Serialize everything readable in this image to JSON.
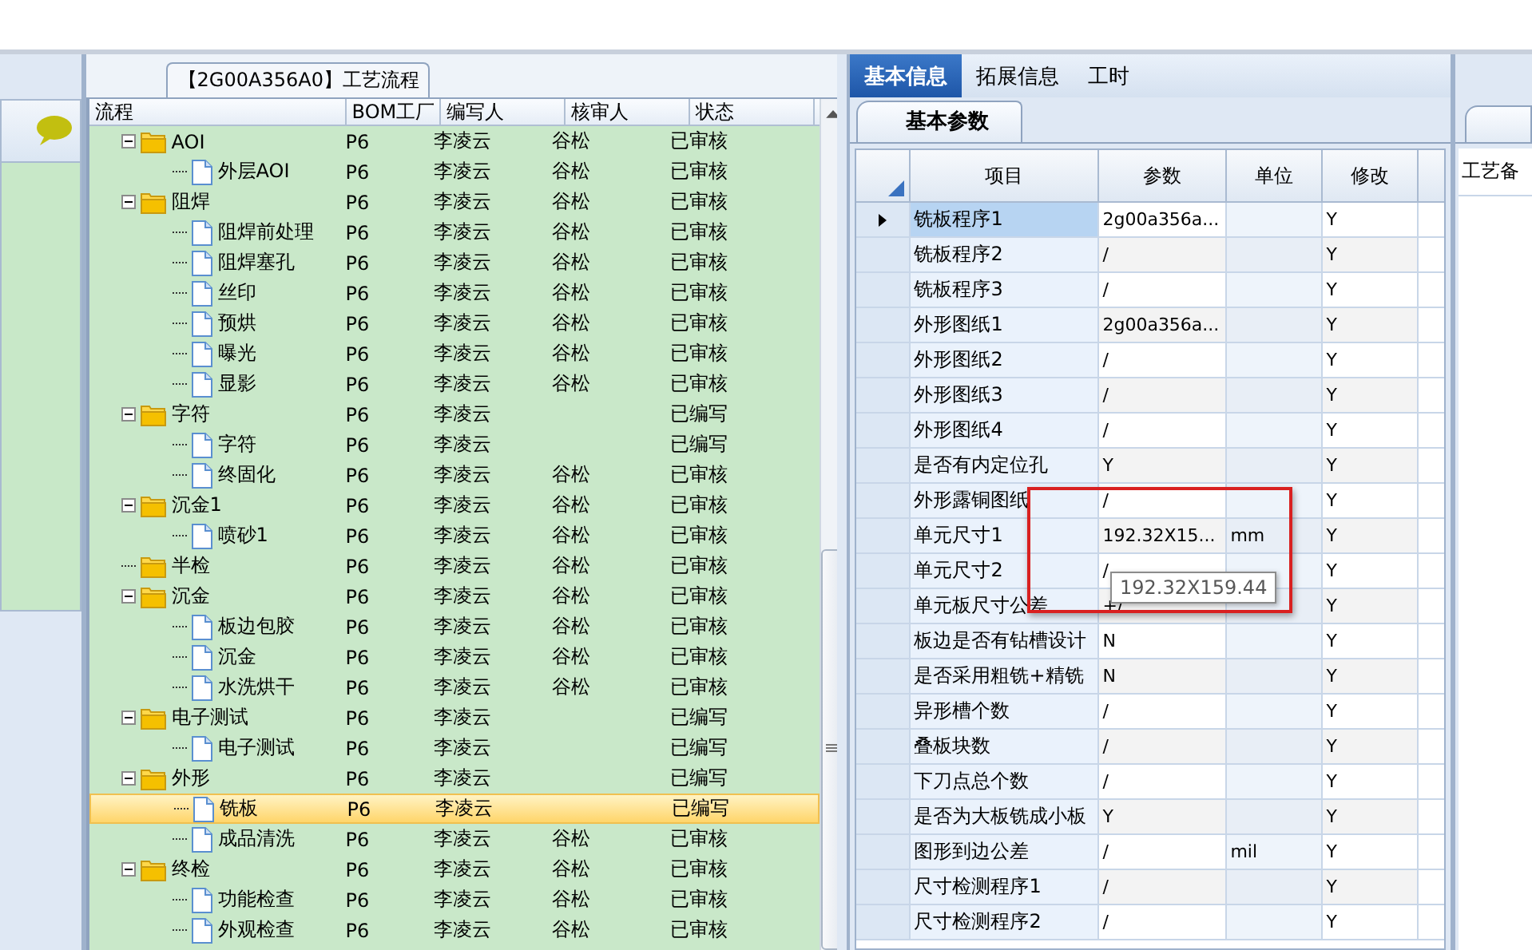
{
  "tree_panel": {
    "title": "【2G00A356A0】工艺流程",
    "columns": [
      "流程",
      "BOM工厂",
      "编写人",
      "核审人",
      "状态"
    ],
    "rows": [
      {
        "name": "AOI",
        "factory": "P6",
        "writer": "李凌云",
        "reviewer": "谷松",
        "status": "已审核",
        "selected": false,
        "expanded": true,
        "children": [
          {
            "name": "外层AOI",
            "factory": "P6",
            "writer": "李凌云",
            "reviewer": "谷松",
            "status": "已审核",
            "selected": false
          }
        ]
      },
      {
        "name": "阻焊",
        "factory": "P6",
        "writer": "李凌云",
        "reviewer": "谷松",
        "status": "已审核",
        "selected": false,
        "expanded": true,
        "children": [
          {
            "name": "阻焊前处理",
            "factory": "P6",
            "writer": "李凌云",
            "reviewer": "谷松",
            "status": "已审核",
            "selected": false
          },
          {
            "name": "阻焊塞孔",
            "factory": "P6",
            "writer": "李凌云",
            "reviewer": "谷松",
            "status": "已审核",
            "selected": false
          },
          {
            "name": "丝印",
            "factory": "P6",
            "writer": "李凌云",
            "reviewer": "谷松",
            "status": "已审核",
            "selected": false
          },
          {
            "name": "预烘",
            "factory": "P6",
            "writer": "李凌云",
            "reviewer": "谷松",
            "status": "已审核",
            "selected": false
          },
          {
            "name": "曝光",
            "factory": "P6",
            "writer": "李凌云",
            "reviewer": "谷松",
            "status": "已审核",
            "selected": false
          },
          {
            "name": "显影",
            "factory": "P6",
            "writer": "李凌云",
            "reviewer": "谷松",
            "status": "已审核",
            "selected": false
          }
        ]
      },
      {
        "name": "字符",
        "factory": "P6",
        "writer": "李凌云",
        "status": "已编写",
        "selected": false,
        "expanded": true,
        "children": [
          {
            "name": "字符",
            "factory": "P6",
            "writer": "李凌云",
            "status": "已编写",
            "selected": false
          },
          {
            "name": "终固化",
            "factory": "P6",
            "writer": "李凌云",
            "reviewer": "谷松",
            "status": "已审核",
            "selected": false
          }
        ]
      },
      {
        "name": "沉金1",
        "factory": "P6",
        "writer": "李凌云",
        "reviewer": "谷松",
        "status": "已审核",
        "selected": false,
        "expanded": true,
        "children": [
          {
            "name": "喷砂1",
            "factory": "P6",
            "writer": "李凌云",
            "reviewer": "谷松",
            "status": "已审核",
            "selected": false
          }
        ]
      },
      {
        "name": "半检",
        "factory": "P6",
        "writer": "李凌云",
        "reviewer": "谷松",
        "status": "已审核",
        "selected": false
      },
      {
        "name": "沉金",
        "factory": "P6",
        "writer": "李凌云",
        "reviewer": "谷松",
        "status": "已审核",
        "selected": false,
        "expanded": true,
        "children": [
          {
            "name": "板边包胶",
            "factory": "P6",
            "writer": "李凌云",
            "reviewer": "谷松",
            "status": "已审核",
            "selected": false
          },
          {
            "name": "沉金",
            "factory": "P6",
            "writer": "李凌云",
            "reviewer": "谷松",
            "status": "已审核",
            "selected": false
          },
          {
            "name": "水洗烘干",
            "factory": "P6",
            "writer": "李凌云",
            "reviewer": "谷松",
            "status": "已审核",
            "selected": false
          }
        ]
      },
      {
        "name": "电子测试",
        "factory": "P6",
        "writer": "李凌云",
        "status": "已编写",
        "selected": false,
        "expanded": true,
        "children": [
          {
            "name": "电子测试",
            "factory": "P6",
            "writer": "李凌云",
            "status": "已编写",
            "selected": false
          }
        ]
      },
      {
        "name": "外形",
        "factory": "P6",
        "writer": "李凌云",
        "status": "已编写",
        "selected": false,
        "expanded": true,
        "children": [
          {
            "name": "铣板",
            "factory": "P6",
            "writer": "李凌云",
            "status": "已编写",
            "selected": true
          },
          {
            "name": "成品清洗",
            "factory": "P6",
            "writer": "李凌云",
            "reviewer": "谷松",
            "status": "已审核",
            "selected": false
          }
        ]
      },
      {
        "name": "终检",
        "factory": "P6",
        "writer": "李凌云",
        "reviewer": "谷松",
        "status": "已审核",
        "selected": false,
        "expanded": true,
        "children": [
          {
            "name": "功能检查",
            "factory": "P6",
            "writer": "李凌云",
            "reviewer": "谷松",
            "status": "已审核",
            "selected": false
          },
          {
            "name": "外观检查",
            "factory": "P6",
            "writer": "李凌云",
            "reviewer": "谷松",
            "status": "已审核",
            "selected": false
          }
        ]
      }
    ]
  },
  "detail_panel": {
    "tabs": [
      {
        "label": "基本信息",
        "selected": true
      },
      {
        "label": "拓展信息",
        "selected": false
      },
      {
        "label": "工时",
        "selected": false
      }
    ],
    "sub_tab": "基本参数",
    "columns": [
      "项目",
      "参数",
      "单位",
      "修改"
    ],
    "rows": [
      {
        "item": "铣板程序1",
        "param": "2g00a356a...",
        "modify": "Y",
        "selected": true
      },
      {
        "item": "铣板程序2",
        "param": "/",
        "modify": "Y",
        "selected": false
      },
      {
        "item": "铣板程序3",
        "param": "/",
        "modify": "Y",
        "selected": false
      },
      {
        "item": "外形图纸1",
        "param": "2g00a356a...",
        "modify": "Y",
        "selected": false
      },
      {
        "item": "外形图纸2",
        "param": "/",
        "modify": "Y",
        "selected": false
      },
      {
        "item": "外形图纸3",
        "param": "/",
        "modify": "Y",
        "selected": false
      },
      {
        "item": "外形图纸4",
        "param": "/",
        "modify": "Y",
        "selected": false
      },
      {
        "item": "是否有内定位孔",
        "param": "Y",
        "modify": "Y",
        "selected": false
      },
      {
        "item": "外形露铜图纸",
        "param": "/",
        "modify": "Y",
        "selected": false
      },
      {
        "item": "单元尺寸1",
        "param": "192.32X15...",
        "unit": "mm",
        "modify": "Y",
        "selected": false
      },
      {
        "item": "单元尺寸2",
        "param": "/",
        "modify": "Y",
        "selected": false
      },
      {
        "item": "单元板尺寸公差",
        "param": "+/",
        "modify": "Y",
        "selected": false
      },
      {
        "item": "板边是否有钻槽设计",
        "param": "N",
        "modify": "Y",
        "selected": false
      },
      {
        "item": "是否采用粗铣+精铣",
        "param": "N",
        "modify": "Y",
        "selected": false
      },
      {
        "item": "异形槽个数",
        "param": "/",
        "modify": "Y",
        "selected": false
      },
      {
        "item": "叠板块数",
        "param": "/",
        "modify": "Y",
        "selected": false
      },
      {
        "item": "下刀点总个数",
        "param": "/",
        "modify": "Y",
        "selected": false
      },
      {
        "item": "是否为大板铣成小板",
        "param": "Y",
        "modify": "Y",
        "selected": false
      },
      {
        "item": "图形到边公差",
        "param": "/",
        "unit": "mil",
        "modify": "Y",
        "selected": false
      },
      {
        "item": "尺寸检测程序1",
        "param": "/",
        "modify": "Y",
        "selected": false
      },
      {
        "item": "尺寸检测程序2",
        "param": "/",
        "modify": "Y",
        "selected": false
      }
    ],
    "tooltip": "192.32X159.44"
  },
  "notes_panel": {
    "label": "工艺备"
  }
}
